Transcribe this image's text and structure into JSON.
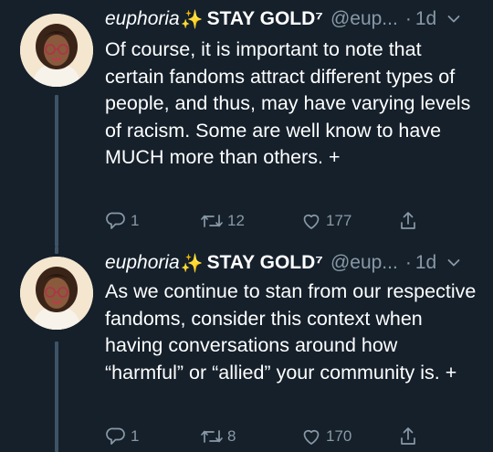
{
  "tweets": [
    {
      "display_name": "euphoria",
      "name_suffix": "STAY GOLD⁷",
      "sparkle": "✨",
      "handle": "@eup...",
      "separator": "·",
      "time": "1d",
      "text": "Of course, it is important to note that certain fandoms attract different types of people, and thus, may have varying levels of racism. Some are well know to have MUCH more than others. +",
      "replies": "1",
      "retweets": "12",
      "likes": "177"
    },
    {
      "display_name": "euphoria",
      "name_suffix": "STAY GOLD⁷",
      "sparkle": "✨",
      "handle": "@eup...",
      "separator": "·",
      "time": "1d",
      "text": "As we continue to stan from our respective fandoms, consider this context when having conversations around how “harmful” or “allied” your community is. +",
      "replies": "1",
      "retweets": "8",
      "likes": "170"
    }
  ],
  "colors": {
    "background": "#15202b",
    "muted": "#8899a6",
    "thread_line": "#3d5466"
  },
  "icons": [
    "avatar",
    "chevron-down-icon",
    "reply-icon",
    "retweet-icon",
    "like-icon",
    "share-icon"
  ]
}
